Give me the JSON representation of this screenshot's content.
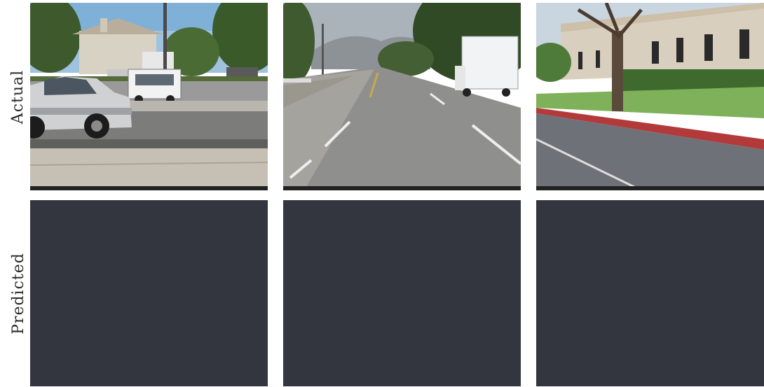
{
  "rows": {
    "actual_label": "Actual",
    "predicted_label": "Predicted"
  },
  "images": {
    "actual": [
      {
        "scene": "suburban street with parked silver SUV, white golf cart, building and trees"
      },
      {
        "scene": "multi-lane road with yellow center line, white truck on right, trees and hills"
      },
      {
        "scene": "street with red curb, tree, lawn and beige building"
      }
    ],
    "predicted": [
      {
        "fill": "#33363e"
      },
      {
        "fill": "#33363e"
      },
      {
        "fill": "#33363e"
      }
    ]
  },
  "colors": {
    "predicted_panel": "#33363e",
    "label_text": "#2a2a2a",
    "background": "#ffffff"
  }
}
